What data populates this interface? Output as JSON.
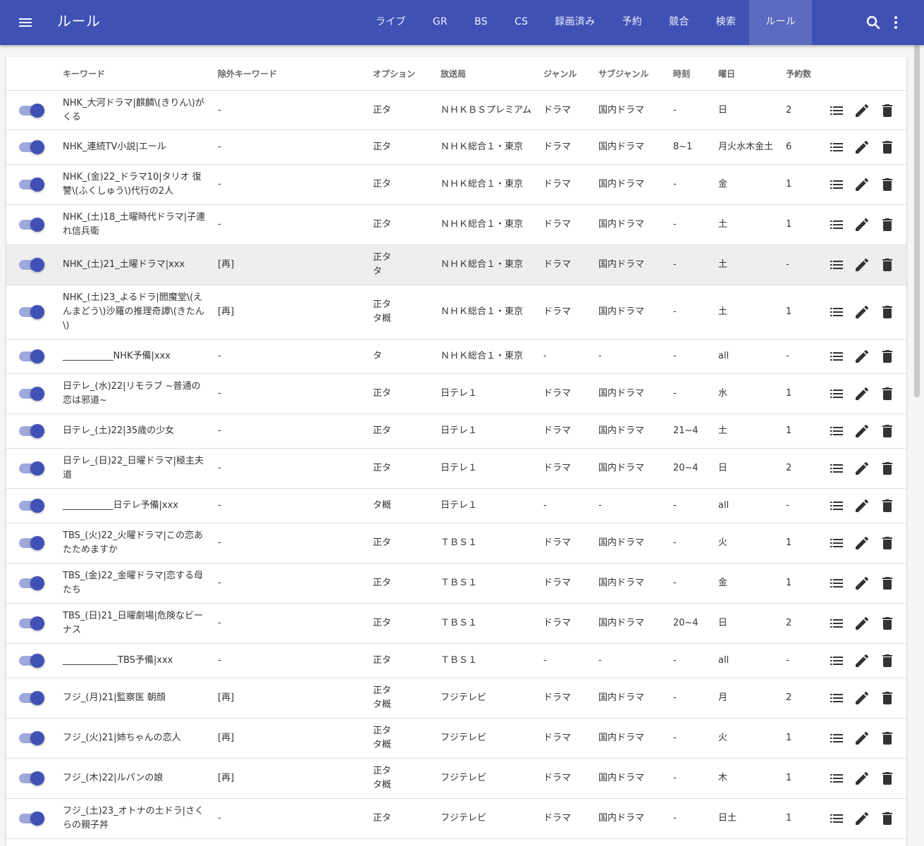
{
  "app": {
    "title": "ルール"
  },
  "nav": {
    "tabs": [
      "ライブ",
      "GR",
      "BS",
      "CS",
      "録画済み",
      "予約",
      "競合",
      "検索",
      "ルール"
    ],
    "active": "ルール"
  },
  "icons": {
    "menu": "menu-icon",
    "search": "search-icon",
    "more": "more-vert-icon",
    "list": "list-icon",
    "edit": "pencil-icon",
    "delete": "trash-icon"
  },
  "colors": {
    "primary": "#3f51b5",
    "active_tab": "#5c6bc0",
    "toggle_track": "#9fa8da"
  },
  "table": {
    "headers": [
      "キーワード",
      "除外キーワード",
      "オプション",
      "放送局",
      "ジャンル",
      "サブジャンル",
      "時刻",
      "曜日",
      "予約数"
    ],
    "rows": [
      {
        "enabled": true,
        "keyword": "NHK_大河ドラマ|麒麟\\(きりん\\)がくる",
        "ignore": "-",
        "option": "正タ",
        "station": "ＮＨＫＢＳプレミアム",
        "genre": "ドラマ",
        "subgenre": "国内ドラマ",
        "time": "-",
        "week": "日",
        "reserves": "2"
      },
      {
        "enabled": true,
        "keyword": "NHK_連続TV小説|エール",
        "ignore": "-",
        "option": "正タ",
        "station": "ＮＨＫ総合１・東京",
        "genre": "ドラマ",
        "subgenre": "国内ドラマ",
        "time": "8~1",
        "week": "月火水木金土",
        "reserves": "6"
      },
      {
        "enabled": true,
        "keyword": "NHK_(金)22_ドラマ10|タリオ 復讐\\(ふくしゅう\\)代行の2人",
        "ignore": "-",
        "option": "正タ",
        "station": "ＮＨＫ総合１・東京",
        "genre": "ドラマ",
        "subgenre": "国内ドラマ",
        "time": "-",
        "week": "金",
        "reserves": "1"
      },
      {
        "enabled": true,
        "keyword": "NHK_(土)18_土曜時代ドラマ|子連れ信兵衛",
        "ignore": "-",
        "option": "正タ",
        "station": "ＮＨＫ総合１・東京",
        "genre": "ドラマ",
        "subgenre": "国内ドラマ",
        "time": "-",
        "week": "土",
        "reserves": "1"
      },
      {
        "enabled": true,
        "keyword": "NHK_(土)21_土曜ドラマ|xxx",
        "ignore": "[再]",
        "option": "正タ\nタ",
        "station": "ＮＨＫ総合１・東京",
        "genre": "ドラマ",
        "subgenre": "国内ドラマ",
        "time": "-",
        "week": "土",
        "reserves": "-",
        "highlighted": true
      },
      {
        "enabled": true,
        "keyword": "NHK_(土)23_よるドラ|閻魔堂\\(えんまどう\\)沙羅の推理奇譚\\(きたん\\)",
        "ignore": "[再]",
        "option": "正タ\nタ概",
        "station": "ＮＨＫ総合１・東京",
        "genre": "ドラマ",
        "subgenre": "国内ドラマ",
        "time": "-",
        "week": "土",
        "reserves": "1"
      },
      {
        "enabled": true,
        "keyword": "___________NHK予備|xxx",
        "ignore": "-",
        "option": "タ",
        "station": "ＮＨＫ総合１・東京",
        "genre": "-",
        "subgenre": "-",
        "time": "-",
        "week": "all",
        "reserves": "-"
      },
      {
        "enabled": true,
        "keyword": "日テレ_(水)22|リモラブ ~普通の恋は邪道~",
        "ignore": "-",
        "option": "正タ",
        "station": "日テレ１",
        "genre": "ドラマ",
        "subgenre": "国内ドラマ",
        "time": "-",
        "week": "水",
        "reserves": "1"
      },
      {
        "enabled": true,
        "keyword": "日テレ_(土)22|35歳の少女",
        "ignore": "-",
        "option": "正タ",
        "station": "日テレ１",
        "genre": "ドラマ",
        "subgenre": "国内ドラマ",
        "time": "21~4",
        "week": "土",
        "reserves": "1"
      },
      {
        "enabled": true,
        "keyword": "日テレ_(日)22_日曜ドラマ|極主夫道",
        "ignore": "-",
        "option": "正タ",
        "station": "日テレ１",
        "genre": "ドラマ",
        "subgenre": "国内ドラマ",
        "time": "20~4",
        "week": "日",
        "reserves": "2"
      },
      {
        "enabled": true,
        "keyword": "___________日テレ予備|xxx",
        "ignore": "-",
        "option": "タ概",
        "station": "日テレ１",
        "genre": "-",
        "subgenre": "-",
        "time": "-",
        "week": "all",
        "reserves": "-"
      },
      {
        "enabled": true,
        "keyword": "TBS_(火)22_火曜ドラマ|この恋あたためますか",
        "ignore": "-",
        "option": "正タ",
        "station": "ＴＢＳ１",
        "genre": "ドラマ",
        "subgenre": "国内ドラマ",
        "time": "-",
        "week": "火",
        "reserves": "1"
      },
      {
        "enabled": true,
        "keyword": "TBS_(金)22_金曜ドラマ|恋する母たち",
        "ignore": "-",
        "option": "正タ",
        "station": "ＴＢＳ１",
        "genre": "ドラマ",
        "subgenre": "国内ドラマ",
        "time": "-",
        "week": "金",
        "reserves": "1"
      },
      {
        "enabled": true,
        "keyword": "TBS_(日)21_日曜劇場|危険なビーナス",
        "ignore": "-",
        "option": "正タ",
        "station": "ＴＢＳ１",
        "genre": "ドラマ",
        "subgenre": "国内ドラマ",
        "time": "20~4",
        "week": "日",
        "reserves": "2"
      },
      {
        "enabled": true,
        "keyword": "____________TBS予備|xxx",
        "ignore": "-",
        "option": "正タ",
        "station": "ＴＢＳ１",
        "genre": "-",
        "subgenre": "-",
        "time": "-",
        "week": "all",
        "reserves": "-"
      },
      {
        "enabled": true,
        "keyword": "フジ_(月)21|監察医 朝顔",
        "ignore": "[再]",
        "option": "正タ\nタ概",
        "station": "フジテレビ",
        "genre": "ドラマ",
        "subgenre": "国内ドラマ",
        "time": "-",
        "week": "月",
        "reserves": "2"
      },
      {
        "enabled": true,
        "keyword": "フジ_(火)21|姉ちゃんの恋人",
        "ignore": "[再]",
        "option": "正タ\nタ概",
        "station": "フジテレビ",
        "genre": "ドラマ",
        "subgenre": "国内ドラマ",
        "time": "-",
        "week": "火",
        "reserves": "1"
      },
      {
        "enabled": true,
        "keyword": "フジ_(木)22|ルパンの娘",
        "ignore": "[再]",
        "option": "正タ\nタ概",
        "station": "フジテレビ",
        "genre": "ドラマ",
        "subgenre": "国内ドラマ",
        "time": "-",
        "week": "木",
        "reserves": "1"
      },
      {
        "enabled": true,
        "keyword": "フジ_(土)23_オトナの土ドラ|さくらの親子丼",
        "ignore": "-",
        "option": "正タ",
        "station": "フジテレビ",
        "genre": "ドラマ",
        "subgenre": "国内ドラマ",
        "time": "-",
        "week": "日土",
        "reserves": "1"
      }
    ]
  }
}
